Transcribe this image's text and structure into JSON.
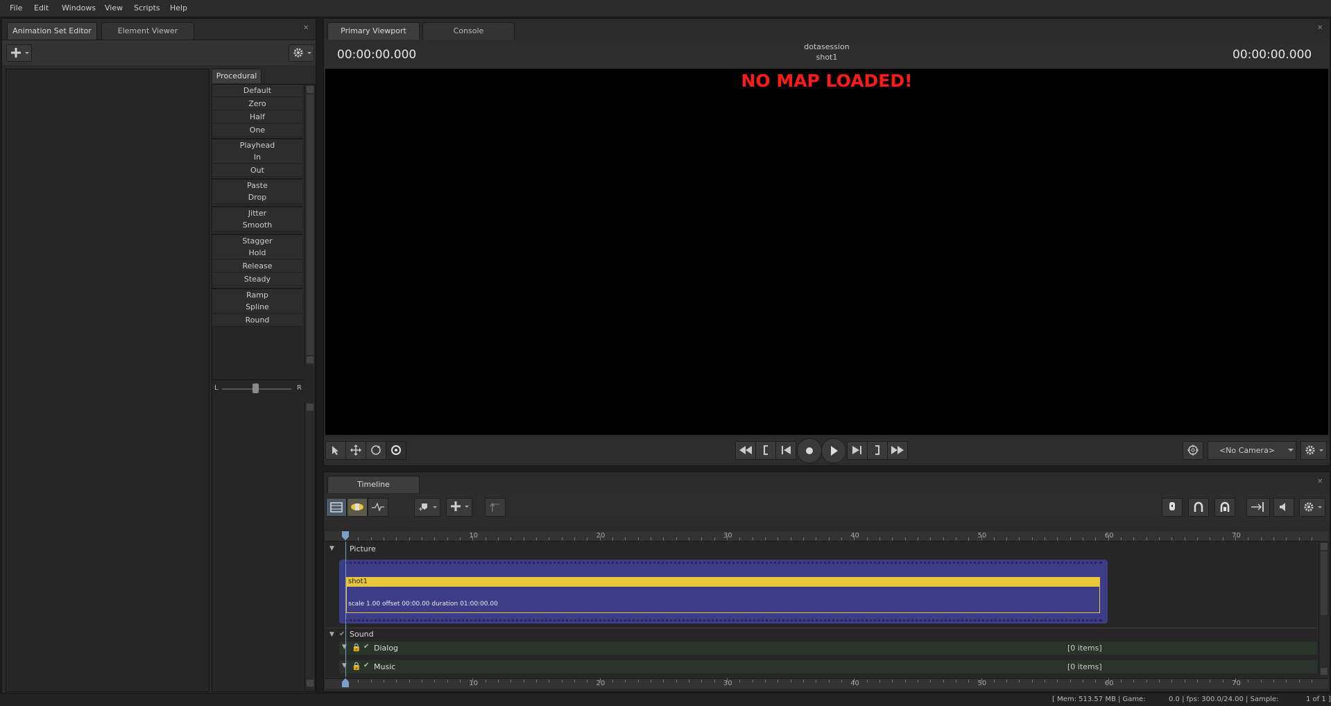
{
  "menu": [
    "File",
    "Edit",
    "Windows",
    "View",
    "Scripts",
    "Help"
  ],
  "left_panel": {
    "tabs": [
      "Animation Set Editor",
      "Element Viewer"
    ],
    "procedural_tab": "Procedural",
    "procedural_items": [
      "Default",
      "Zero",
      "Half",
      "One",
      "Playhead",
      "In",
      "Out",
      "Paste",
      "Drop",
      "Jitter",
      "Smooth",
      "Stagger",
      "Hold",
      "Release",
      "Steady",
      "Ramp",
      "Spline",
      "Round"
    ],
    "balance_left": "L",
    "balance_right": "R"
  },
  "viewport": {
    "tabs": [
      "Primary Viewport",
      "Console"
    ],
    "session_name": "dotasession",
    "shot_name": "shot1",
    "timecode_left": "00:00:00.000",
    "timecode_right": "00:00:00.000",
    "message": "NO MAP LOADED!",
    "camera_select": "<No Camera>"
  },
  "timeline": {
    "tab": "Timeline",
    "ruler_labels": [
      "10",
      "20",
      "30",
      "40",
      "50",
      "60",
      "70"
    ],
    "picture_label": "Picture",
    "clip_name": "shot1",
    "clip_info": "scale 1.00  offset  00:00.00  duration  01:00:00.00",
    "sound_label": "Sound",
    "sound_tracks": [
      {
        "name": "Dialog",
        "count": "[0 items]"
      },
      {
        "name": "Music",
        "count": "[0 items]"
      }
    ]
  },
  "status_bar": {
    "mem": "[ Mem:    513.57 MB | Game:",
    "fps": "0.0 | fps:  300.0/24.00 | Sample:",
    "page": "1 of 1 ]"
  },
  "colors": {
    "accent_yellow": "#e8c53a",
    "clip_purple": "#3d3c86",
    "message_red": "#ff1a1a"
  }
}
